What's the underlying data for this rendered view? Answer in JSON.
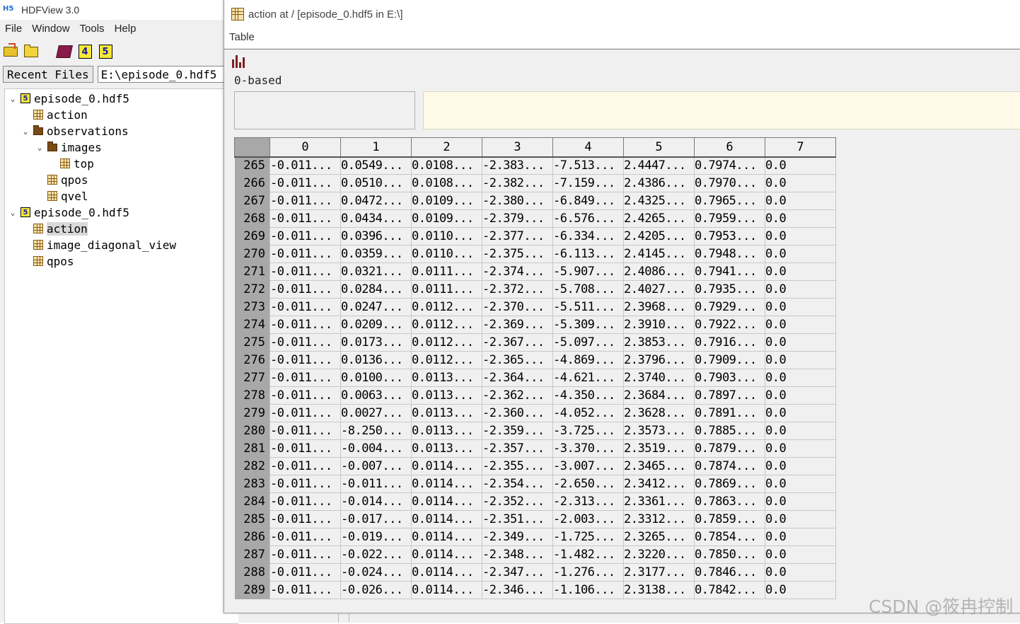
{
  "app": {
    "title": "HDFView 3.0",
    "logo_text": "H5"
  },
  "menu": [
    "File",
    "Window",
    "Tools",
    "Help"
  ],
  "toolbar": {
    "icons": [
      "open-file-icon",
      "open-folder-icon",
      "help-book-icon",
      "hdf4-icon",
      "hdf5-icon"
    ],
    "hdf4_label": "4",
    "hdf5_label": "5"
  },
  "recent": {
    "button_label": "Recent Files",
    "path_value": "E:\\episode_0.hdf5"
  },
  "tree": [
    {
      "label": "episode_0.hdf5",
      "type": "file",
      "depth": 0,
      "expanded": true,
      "selected": false
    },
    {
      "label": "action",
      "type": "dataset",
      "depth": 1,
      "selected": false
    },
    {
      "label": "observations",
      "type": "group",
      "depth": 1,
      "expanded": true,
      "selected": false
    },
    {
      "label": "images",
      "type": "group",
      "depth": 2,
      "expanded": true,
      "selected": false
    },
    {
      "label": "top",
      "type": "dataset",
      "depth": 3,
      "selected": false
    },
    {
      "label": "qpos",
      "type": "dataset",
      "depth": 2,
      "selected": false
    },
    {
      "label": "qvel",
      "type": "dataset",
      "depth": 2,
      "selected": false
    },
    {
      "label": "episode_0.hdf5",
      "type": "file",
      "depth": 0,
      "expanded": true,
      "selected": false
    },
    {
      "label": "action",
      "type": "dataset",
      "depth": 1,
      "selected": true
    },
    {
      "label": "image_diagonal_view",
      "type": "dataset",
      "depth": 1,
      "selected": false
    },
    {
      "label": "qpos",
      "type": "dataset",
      "depth": 1,
      "selected": false
    }
  ],
  "dataset_window": {
    "title": "action  at  /  [episode_0.hdf5  in  E:\\]",
    "menu_label": "Table",
    "index_base": "0-based",
    "cell_label": "",
    "cell_value": ""
  },
  "table": {
    "columns": [
      "0",
      "1",
      "2",
      "3",
      "4",
      "5",
      "6",
      "7"
    ],
    "rows": [
      {
        "index": "265",
        "cells": [
          "-0.011...",
          "0.0549...",
          "0.0108...",
          "-2.383...",
          "-7.513...",
          "2.4447...",
          "0.7974...",
          "0.0"
        ]
      },
      {
        "index": "266",
        "cells": [
          "-0.011...",
          "0.0510...",
          "0.0108...",
          "-2.382...",
          "-7.159...",
          "2.4386...",
          "0.7970...",
          "0.0"
        ]
      },
      {
        "index": "267",
        "cells": [
          "-0.011...",
          "0.0472...",
          "0.0109...",
          "-2.380...",
          "-6.849...",
          "2.4325...",
          "0.7965...",
          "0.0"
        ]
      },
      {
        "index": "268",
        "cells": [
          "-0.011...",
          "0.0434...",
          "0.0109...",
          "-2.379...",
          "-6.576...",
          "2.4265...",
          "0.7959...",
          "0.0"
        ]
      },
      {
        "index": "269",
        "cells": [
          "-0.011...",
          "0.0396...",
          "0.0110...",
          "-2.377...",
          "-6.334...",
          "2.4205...",
          "0.7953...",
          "0.0"
        ]
      },
      {
        "index": "270",
        "cells": [
          "-0.011...",
          "0.0359...",
          "0.0110...",
          "-2.375...",
          "-6.113...",
          "2.4145...",
          "0.7948...",
          "0.0"
        ]
      },
      {
        "index": "271",
        "cells": [
          "-0.011...",
          "0.0321...",
          "0.0111...",
          "-2.374...",
          "-5.907...",
          "2.4086...",
          "0.7941...",
          "0.0"
        ]
      },
      {
        "index": "272",
        "cells": [
          "-0.011...",
          "0.0284...",
          "0.0111...",
          "-2.372...",
          "-5.708...",
          "2.4027...",
          "0.7935...",
          "0.0"
        ]
      },
      {
        "index": "273",
        "cells": [
          "-0.011...",
          "0.0247...",
          "0.0112...",
          "-2.370...",
          "-5.511...",
          "2.3968...",
          "0.7929...",
          "0.0"
        ]
      },
      {
        "index": "274",
        "cells": [
          "-0.011...",
          "0.0209...",
          "0.0112...",
          "-2.369...",
          "-5.309...",
          "2.3910...",
          "0.7922...",
          "0.0"
        ]
      },
      {
        "index": "275",
        "cells": [
          "-0.011...",
          "0.0173...",
          "0.0112...",
          "-2.367...",
          "-5.097...",
          "2.3853...",
          "0.7916...",
          "0.0"
        ]
      },
      {
        "index": "276",
        "cells": [
          "-0.011...",
          "0.0136...",
          "0.0112...",
          "-2.365...",
          "-4.869...",
          "2.3796...",
          "0.7909...",
          "0.0"
        ]
      },
      {
        "index": "277",
        "cells": [
          "-0.011...",
          "0.0100...",
          "0.0113...",
          "-2.364...",
          "-4.621...",
          "2.3740...",
          "0.7903...",
          "0.0"
        ]
      },
      {
        "index": "278",
        "cells": [
          "-0.011...",
          "0.0063...",
          "0.0113...",
          "-2.362...",
          "-4.350...",
          "2.3684...",
          "0.7897...",
          "0.0"
        ]
      },
      {
        "index": "279",
        "cells": [
          "-0.011...",
          "0.0027...",
          "0.0113...",
          "-2.360...",
          "-4.052...",
          "2.3628...",
          "0.7891...",
          "0.0"
        ]
      },
      {
        "index": "280",
        "cells": [
          "-0.011...",
          "-8.250...",
          "0.0113...",
          "-2.359...",
          "-3.725...",
          "2.3573...",
          "0.7885...",
          "0.0"
        ]
      },
      {
        "index": "281",
        "cells": [
          "-0.011...",
          "-0.004...",
          "0.0113...",
          "-2.357...",
          "-3.370...",
          "2.3519...",
          "0.7879...",
          "0.0"
        ]
      },
      {
        "index": "282",
        "cells": [
          "-0.011...",
          "-0.007...",
          "0.0114...",
          "-2.355...",
          "-3.007...",
          "2.3465...",
          "0.7874...",
          "0.0"
        ]
      },
      {
        "index": "283",
        "cells": [
          "-0.011...",
          "-0.011...",
          "0.0114...",
          "-2.354...",
          "-2.650...",
          "2.3412...",
          "0.7869...",
          "0.0"
        ]
      },
      {
        "index": "284",
        "cells": [
          "-0.011...",
          "-0.014...",
          "0.0114...",
          "-2.352...",
          "-2.313...",
          "2.3361...",
          "0.7863...",
          "0.0"
        ]
      },
      {
        "index": "285",
        "cells": [
          "-0.011...",
          "-0.017...",
          "0.0114...",
          "-2.351...",
          "-2.003...",
          "2.3312...",
          "0.7859...",
          "0.0"
        ]
      },
      {
        "index": "286",
        "cells": [
          "-0.011...",
          "-0.019...",
          "0.0114...",
          "-2.349...",
          "-1.725...",
          "2.3265...",
          "0.7854...",
          "0.0"
        ]
      },
      {
        "index": "287",
        "cells": [
          "-0.011...",
          "-0.022...",
          "0.0114...",
          "-2.348...",
          "-1.482...",
          "2.3220...",
          "0.7850...",
          "0.0"
        ]
      },
      {
        "index": "288",
        "cells": [
          "-0.011...",
          "-0.024...",
          "0.0114...",
          "-2.347...",
          "-1.276...",
          "2.3177...",
          "0.7846...",
          "0.0"
        ]
      },
      {
        "index": "289",
        "cells": [
          "-0.011...",
          "-0.026...",
          "0.0114...",
          "-2.346...",
          "-1.106...",
          "2.3138...",
          "0.7842...",
          "0.0"
        ]
      }
    ]
  },
  "watermark": "CSDN @筱冉控制",
  "colors": {
    "row_header_bg": "#a8a8a8",
    "cell_value_bg": "#fffbe8",
    "selection_bg": "#d9d9d9"
  }
}
